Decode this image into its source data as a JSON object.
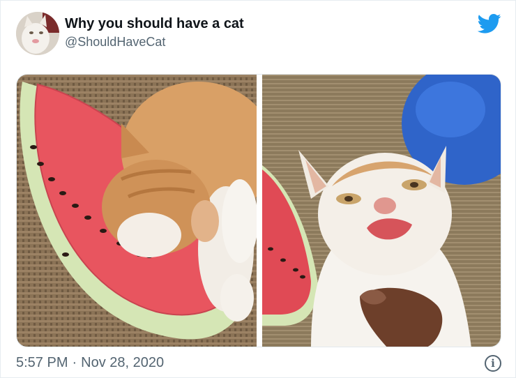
{
  "tweet": {
    "author_name": "Why you should have a cat",
    "author_handle": "@ShouldHaveCat",
    "time": "5:57 PM",
    "date": "Nov 28, 2020",
    "separator": "·",
    "info_glyph": "i"
  },
  "icons": {
    "platform": "twitter-bird-icon",
    "info": "info-icon"
  },
  "colors": {
    "brand": "#1d9bf0",
    "text_primary": "#0f1419",
    "text_secondary": "#536471",
    "border": "#e6ecf0"
  }
}
